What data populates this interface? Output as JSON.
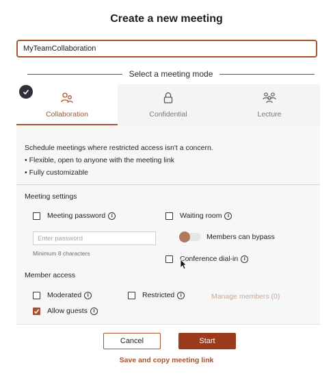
{
  "dialog": {
    "title": "Create a new meeting",
    "meeting_name_value": "MyTeamCollaboration",
    "mode_label": "Select a meeting mode"
  },
  "tabs": [
    {
      "label": "Collaboration",
      "icon": "collaboration-users-icon",
      "selected": true
    },
    {
      "label": "Confidential",
      "icon": "lock-icon",
      "selected": false
    },
    {
      "label": "Lecture",
      "icon": "audience-icon",
      "selected": false
    }
  ],
  "description": {
    "line1": "Schedule meetings where restricted access isn't a concern.",
    "line2": "• Flexible, open to anyone with the meeting link",
    "line3": "• Fully customizable"
  },
  "settings": {
    "section_label": "Meeting settings",
    "meeting_password": {
      "label": "Meeting password",
      "checked": false
    },
    "password_placeholder": "Enter password",
    "password_hint": "Minimum 8 characters",
    "waiting_room": {
      "label": "Waiting room",
      "checked": false
    },
    "members_bypass": {
      "label": "Members can bypass",
      "on": false
    },
    "conference_dialin": {
      "label": "Conference dial-in",
      "checked": false
    }
  },
  "access": {
    "section_label": "Member access",
    "moderated": {
      "label": "Moderated",
      "checked": false
    },
    "restricted": {
      "label": "Restricted",
      "checked": false
    },
    "manage_members": "Manage members (0)",
    "allow_guests": {
      "label": "Allow guests",
      "checked": true
    }
  },
  "footer": {
    "cancel_label": "Cancel",
    "start_label": "Start",
    "save_link": "Save and copy meeting link"
  },
  "colors": {
    "accent": "#a7522e",
    "start_button": "#9b3a1c",
    "disabled_link": "#c9a797"
  }
}
